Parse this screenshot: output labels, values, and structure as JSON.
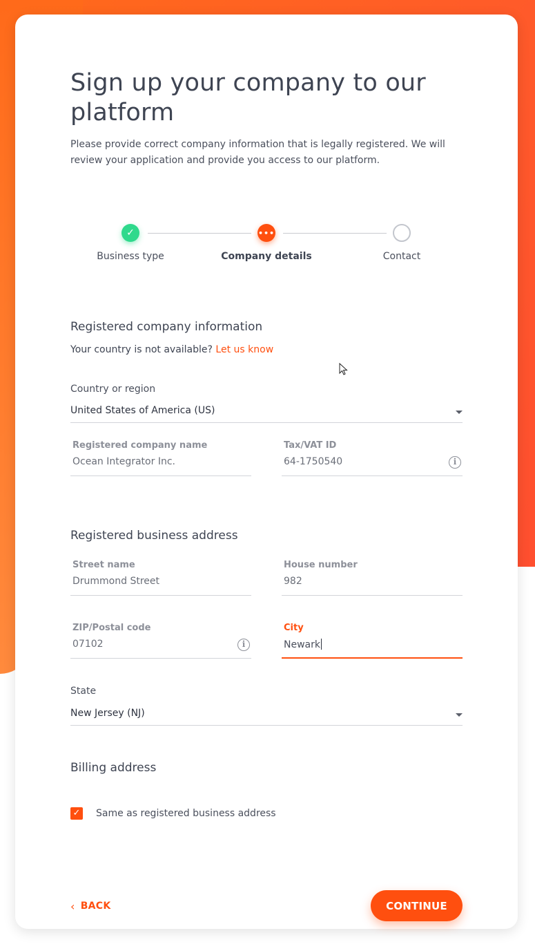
{
  "header": {
    "title": "Sign up your company to our platform",
    "subtitle": "Please provide correct company information that is legally registered. We will review your application and provide you access to our platform."
  },
  "stepper": {
    "steps": [
      {
        "label": "Business type",
        "state": "done",
        "icon": "check-icon"
      },
      {
        "label": "Company details",
        "state": "active",
        "icon": "more-dots-icon"
      },
      {
        "label": "Contact",
        "state": "todo",
        "icon": "empty-circle-icon"
      }
    ]
  },
  "company_info": {
    "section_title": "Registered company information",
    "note_prefix": "Your country is not available?",
    "note_link": "Let us know",
    "country_label": "Country or region",
    "country_value": "United States of America (US)",
    "company_name_label": "Registered company name",
    "company_name_value": "Ocean Integrator Inc.",
    "tax_label": "Tax/VAT ID",
    "tax_value": "64-1750540"
  },
  "business_address": {
    "section_title": "Registered business address",
    "street_label": "Street name",
    "street_value": "Drummond Street",
    "house_label": "House number",
    "house_value": "982",
    "zip_label": "ZIP/Postal code",
    "zip_value": "07102",
    "city_label": "City",
    "city_value": "Newark",
    "state_label": "State",
    "state_value": "New Jersey (NJ)"
  },
  "billing": {
    "section_title": "Billing address",
    "same_as_label": "Same as registered business address",
    "same_as_checked": true
  },
  "footer": {
    "back_label": "BACK",
    "continue_label": "CONTINUE"
  },
  "colors": {
    "accent": "#ff4f0f",
    "success": "#2fd98c",
    "text": "#3e4452"
  }
}
